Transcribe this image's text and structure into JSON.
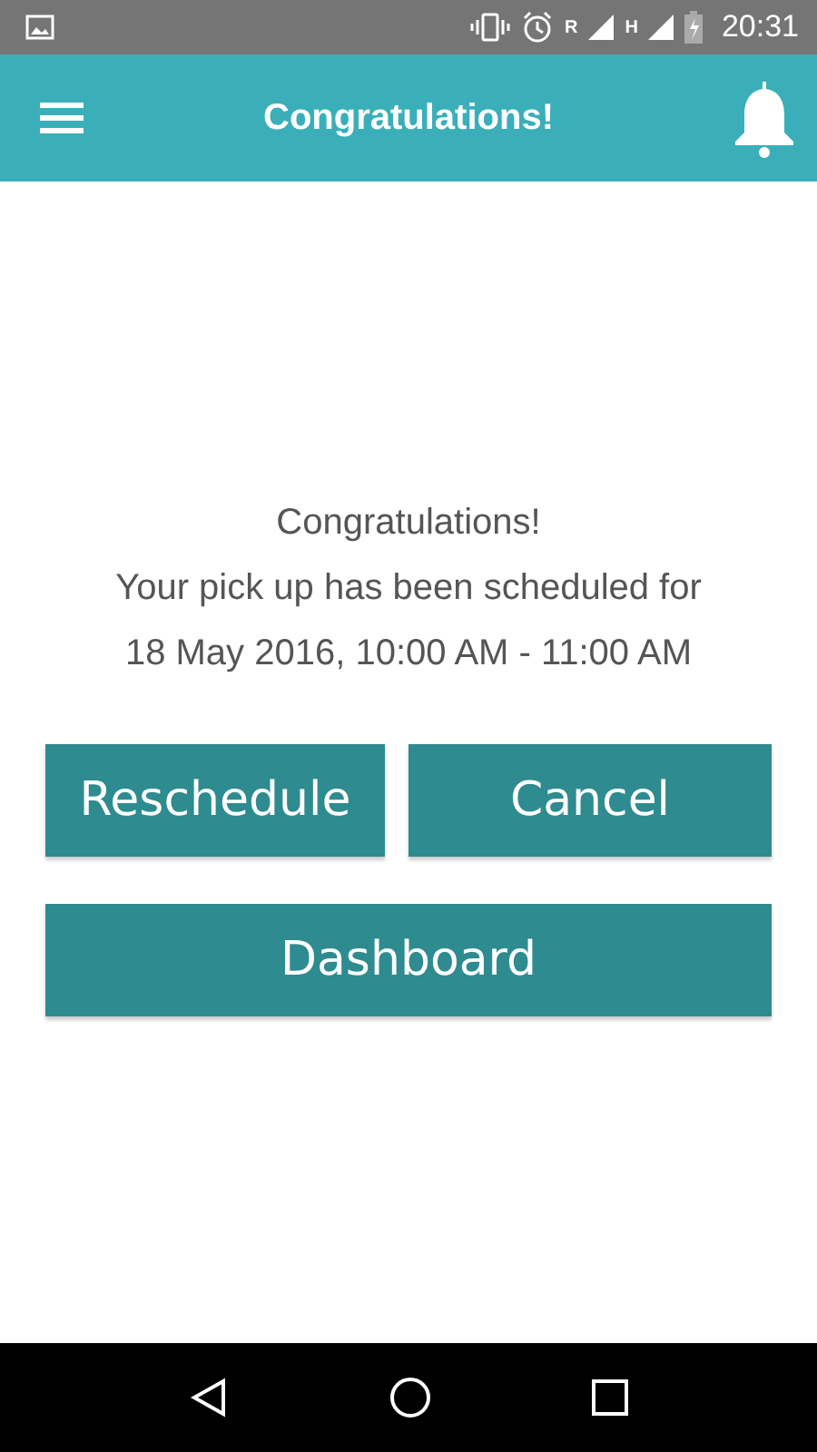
{
  "status_bar": {
    "roaming": "R",
    "network": "H",
    "time": "20:31"
  },
  "app_bar": {
    "title": "Congratulations!"
  },
  "message": {
    "lines": [
      "Congratulations!",
      "Your pick up has been scheduled for",
      "18 May 2016, 10:00 AM - 11:00 AM"
    ]
  },
  "buttons": [
    {
      "label": "Reschedule",
      "kind": "half"
    },
    {
      "label": "Cancel",
      "kind": "half"
    },
    {
      "label": "Dashboard",
      "kind": "full"
    }
  ]
}
